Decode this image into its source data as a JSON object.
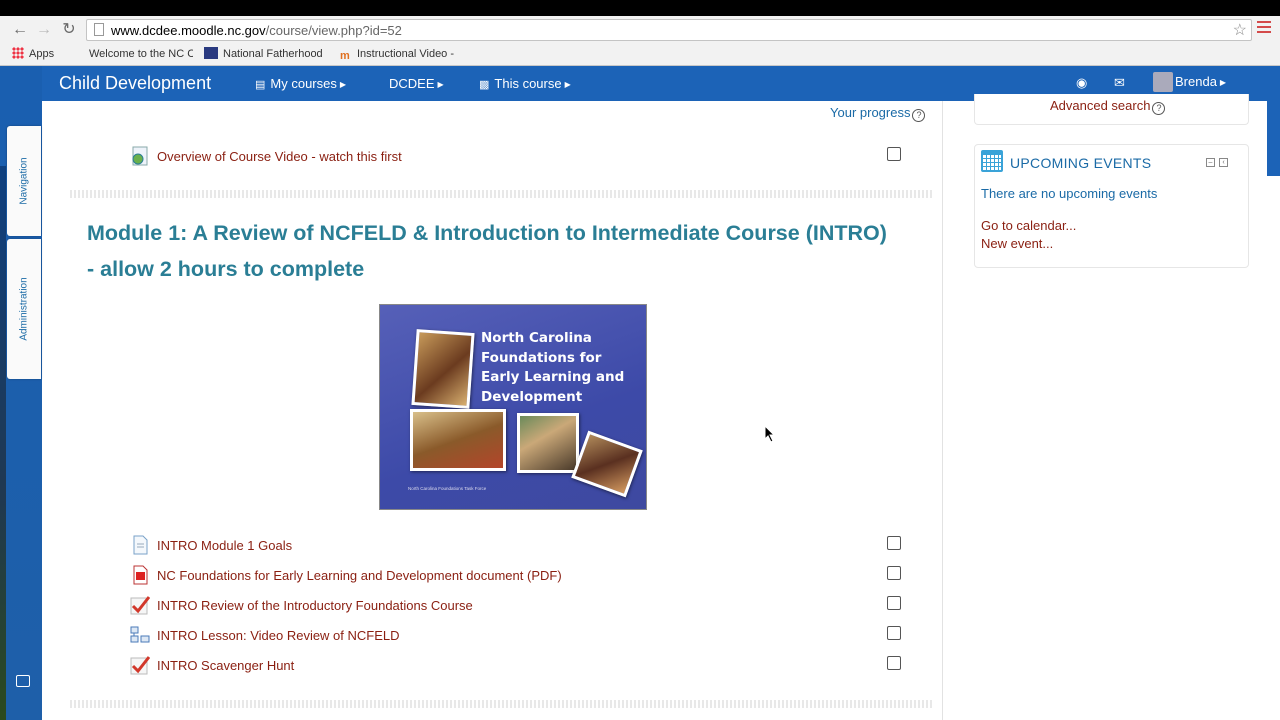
{
  "browser": {
    "url_host": "www.dcdee.moodle.nc.gov",
    "url_path": "/course/view.php?id=52",
    "bookmarks": [
      {
        "label": "Apps"
      },
      {
        "label": "Welcome to the NC C"
      },
      {
        "label": "National Fatherhood"
      },
      {
        "label": "Instructional Video -"
      }
    ]
  },
  "navbar": {
    "brand": "Child Development",
    "items": [
      {
        "label": "My courses"
      },
      {
        "label": "DCDEE"
      },
      {
        "label": "This course"
      }
    ],
    "user": "Brenda"
  },
  "sidebar_tabs": {
    "navigation": "Navigation",
    "administration": "Administration"
  },
  "main": {
    "progress_label": "Your progress",
    "overview_activity": "Overview of Course Video - watch this first",
    "module_title": "Module 1: A Review of NCFELD & Introduction to Intermediate Course (INTRO) - allow 2 hours to complete",
    "image": {
      "title": "North Carolina Foundations for Early Learning and Development",
      "footer": "North Carolina Foundations Task Force"
    },
    "activities": [
      {
        "label": "INTRO Module 1 Goals",
        "icon": "page-icon"
      },
      {
        "label": "NC Foundations for Early Learning and Development document (PDF)",
        "icon": "pdf-icon"
      },
      {
        "label": "INTRO Review of the Introductory Foundations Course",
        "icon": "quiz-icon"
      },
      {
        "label": "INTRO Lesson: Video Review of NCFELD",
        "icon": "lesson-icon"
      },
      {
        "label": "INTRO Scavenger Hunt",
        "icon": "quiz-icon"
      }
    ]
  },
  "blocks": {
    "advanced_search": "Advanced search",
    "upcoming_events": {
      "title": "UPCOMING EVENTS",
      "empty_text": "There are no upcoming events",
      "calendar_link": "Go to calendar...",
      "new_event_link": "New event..."
    }
  }
}
